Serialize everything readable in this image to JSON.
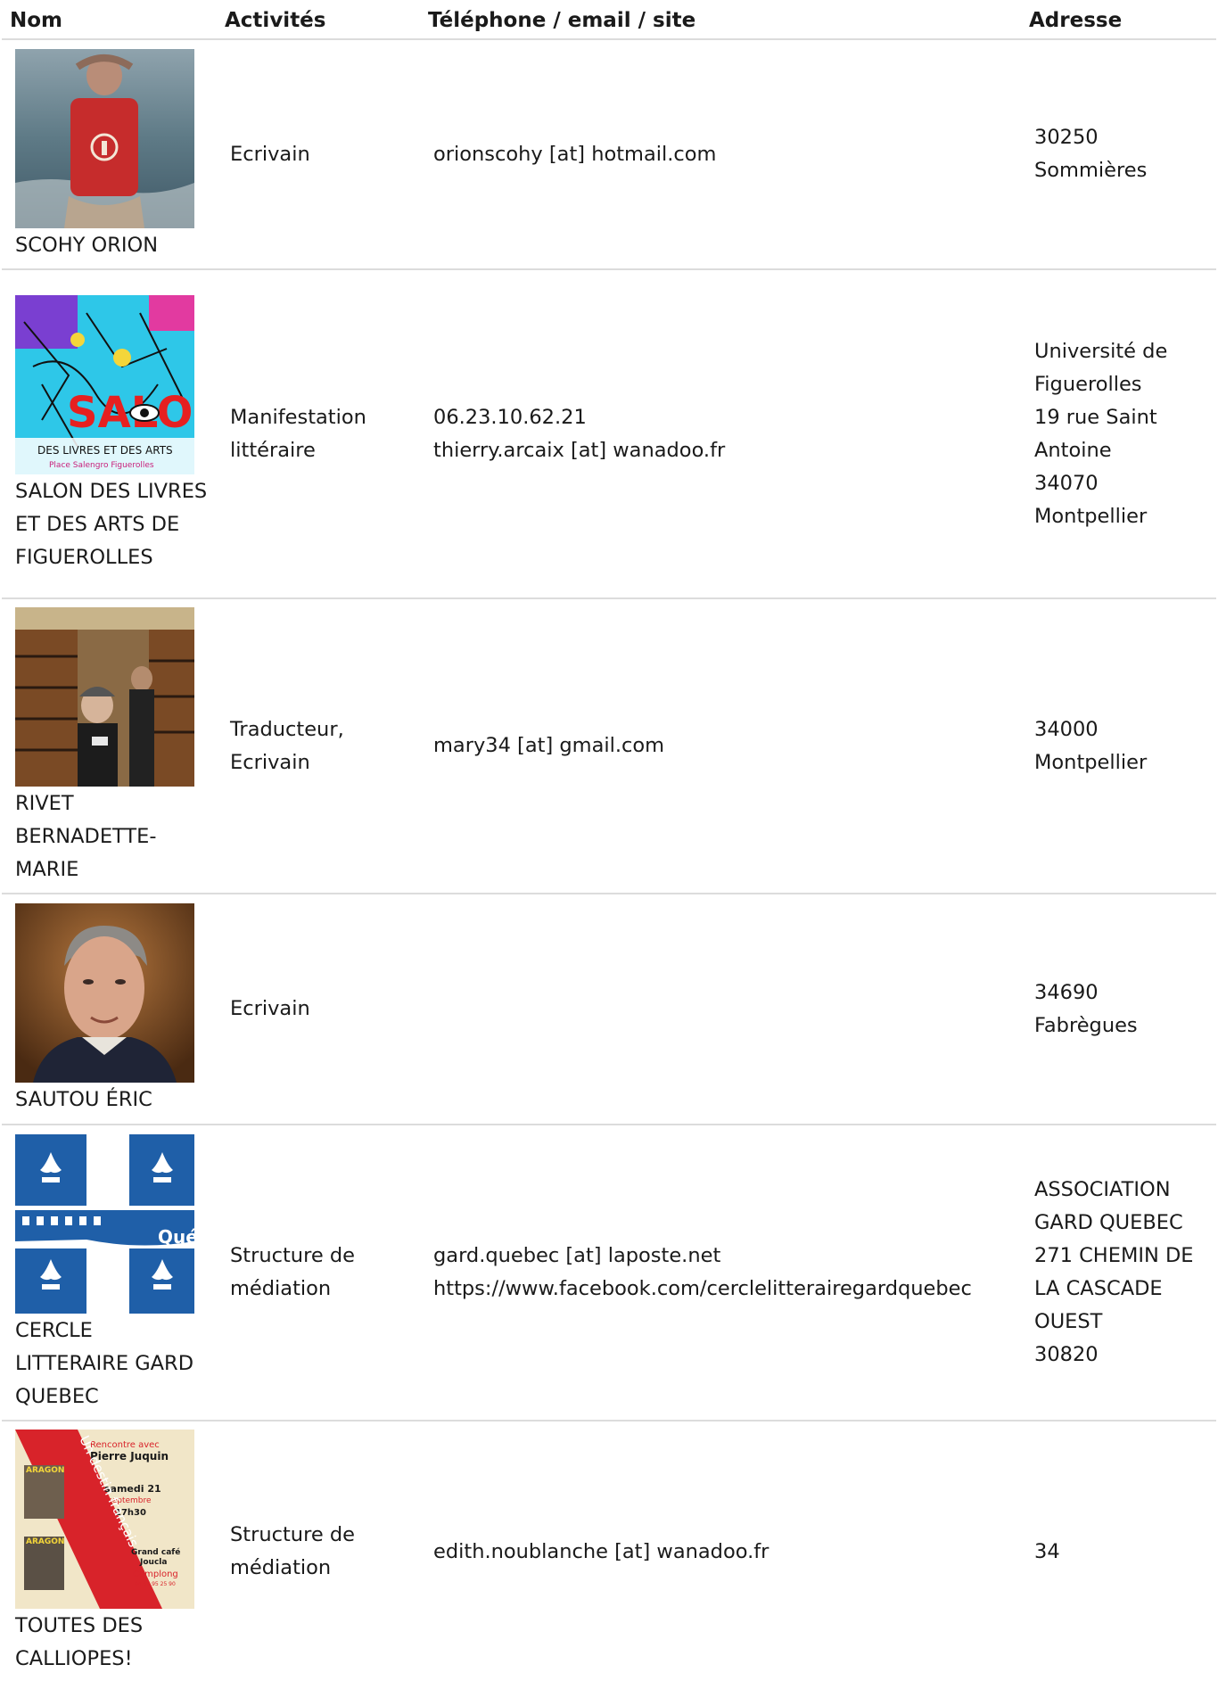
{
  "headers": {
    "nom": "Nom",
    "activites": "Activités",
    "contact": "Téléphone / email / site",
    "adresse": "Adresse"
  },
  "rows": [
    {
      "name": "SCOHY ORION",
      "activity": [
        "Ecrivain"
      ],
      "contact": [
        "orionscohy [at] hotmail.com"
      ],
      "address": [
        "30250",
        "Sommières"
      ],
      "thumb_icon": "person-photo"
    },
    {
      "name": "SALON DES LIVRES ET DES ARTS DE FIGUEROLLES",
      "activity": [
        "Manifestation",
        "littéraire"
      ],
      "contact": [
        "06.23.10.62.21",
        "thierry.arcaix [at] wanadoo.fr"
      ],
      "address": [
        "Université de",
        "Figuerolles",
        "19 rue Saint",
        "Antoine",
        "34070",
        "Montpellier"
      ],
      "thumb_icon": "event-poster",
      "poster_text": {
        "big": "SALON",
        "line1": "DES LIVRES ET DES ARTS",
        "line2": "Place Salengro Figuerolles"
      }
    },
    {
      "name": "RIVET BERNADETTE-MARIE",
      "activity": [
        "Traducteur,",
        "Ecrivain"
      ],
      "contact": [
        "mary34 [at] gmail.com"
      ],
      "address": [
        "34000",
        "Montpellier"
      ],
      "thumb_icon": "library-photo"
    },
    {
      "name": "SAUTOU ÉRIC",
      "activity": [
        "Ecrivain"
      ],
      "contact": [],
      "address": [
        "34690",
        "Fabrègues"
      ],
      "thumb_icon": "portrait-photo"
    },
    {
      "name": "CERCLE LITTERAIRE GARD QUEBEC",
      "activity": [
        "Structure de",
        "médiation"
      ],
      "contact": [
        "gard.quebec [at] laposte.net",
        "https://www.facebook.com/cerclelitterairegardquebec"
      ],
      "address": [
        "ASSOCIATION",
        "GARD QUEBEC",
        "271 CHEMIN DE",
        "LA CASCADE",
        "OUEST",
        "30820"
      ],
      "thumb_icon": "quebec-flag-logo",
      "logo_text": "Qué"
    },
    {
      "name": "TOUTES DES CALLIOPES!",
      "activity": [
        "Structure de",
        "médiation"
      ],
      "contact": [
        "edith.noublanche [at] wanadoo.fr"
      ],
      "address": [
        "34"
      ],
      "thumb_icon": "event-poster",
      "poster_text": {
        "top": "Rencontre avec",
        "who": "Pierre Juquin",
        "date": "samedi 21",
        "month": "septembre",
        "time": "17h30",
        "place1": "Grand café",
        "place2": "Joucla",
        "town": "Camplong",
        "phone": "04 67 95 25 90",
        "side": "Un destin français",
        "book": "ARAGON"
      }
    }
  ],
  "colors": {
    "divider": "#dcdcdc",
    "text": "#1a1a1a",
    "quebec_blue": "#1f5fa8",
    "poster_red": "#d8232a",
    "poster_bg": "#f1e6c8"
  }
}
